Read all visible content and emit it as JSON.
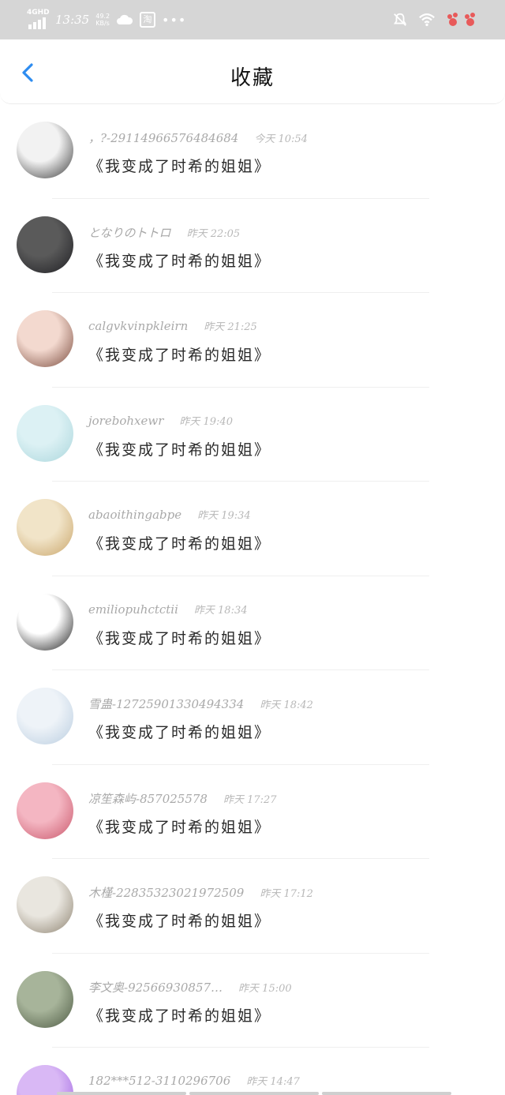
{
  "status_bar": {
    "network": "4GHD",
    "time": "13:35",
    "speed_value": "49.2",
    "speed_unit": "KB/s",
    "taobao_label": "淘",
    "icons": [
      "signal-bars-icon",
      "cloud-icon",
      "taobao-icon",
      "more-dots-icon",
      "mute-bell-icon",
      "wifi-icon",
      "paw-icon"
    ]
  },
  "header": {
    "back_icon": "chevron-left-icon",
    "title": "收藏",
    "accent_color": "#2d8cf0"
  },
  "items": [
    {
      "username": "，?-29114966576484684",
      "time": "今天 10:54",
      "comment": "《我变成了时希的姐姐》",
      "avatar_colors": [
        "#f2f2f2",
        "#3a3a3a"
      ]
    },
    {
      "username": "となりのトトロ",
      "time": "昨天 22:05",
      "comment": "《我变成了时希的姐姐》",
      "avatar_colors": [
        "#5a5a5a",
        "#1e1e22"
      ]
    },
    {
      "username": "calgvkvinpkleirn",
      "time": "昨天 21:25",
      "comment": "《我变成了时希的姐姐》",
      "avatar_colors": [
        "#f3d9cf",
        "#7a4a3c"
      ]
    },
    {
      "username": "jorebohxewr",
      "time": "昨天 19:40",
      "comment": "《我变成了时希的姐姐》",
      "avatar_colors": [
        "#dcf1f4",
        "#aad6dc"
      ]
    },
    {
      "username": "abaoithingabpe",
      "time": "昨天 19:34",
      "comment": "《我变成了时希的姐姐》",
      "avatar_colors": [
        "#f1e4c8",
        "#c9a56a"
      ]
    },
    {
      "username": "emiliopuhctctii",
      "time": "昨天 18:34",
      "comment": "《我变成了时希的姐姐》",
      "avatar_colors": [
        "#ffffff",
        "#1c1c1c"
      ]
    },
    {
      "username": "雪蛊-12725901330494334",
      "time": "昨天 18:42",
      "comment": "《我变成了时希的姐姐》",
      "avatar_colors": [
        "#eef3f8",
        "#b9cde0"
      ]
    },
    {
      "username": "凉笙森屿-857025578",
      "time": "昨天 17:27",
      "comment": "《我变成了时希的姐姐》",
      "avatar_colors": [
        "#f4b6c2",
        "#c9566a"
      ]
    },
    {
      "username": "木槿-22835323021972509",
      "time": "昨天 17:12",
      "comment": "《我变成了时希的姐姐》",
      "avatar_colors": [
        "#e9e6df",
        "#8d8270"
      ]
    },
    {
      "username": "李文奥-92566930857…",
      "time": "昨天 15:00",
      "comment": "《我变成了时希的姐姐》",
      "avatar_colors": [
        "#a7b49a",
        "#4d5a43"
      ]
    },
    {
      "username": "182***512-3110296706",
      "time": "昨天 14:47",
      "comment": "",
      "avatar_colors": [
        "#d9b8f5",
        "#9b5ee0"
      ]
    }
  ]
}
